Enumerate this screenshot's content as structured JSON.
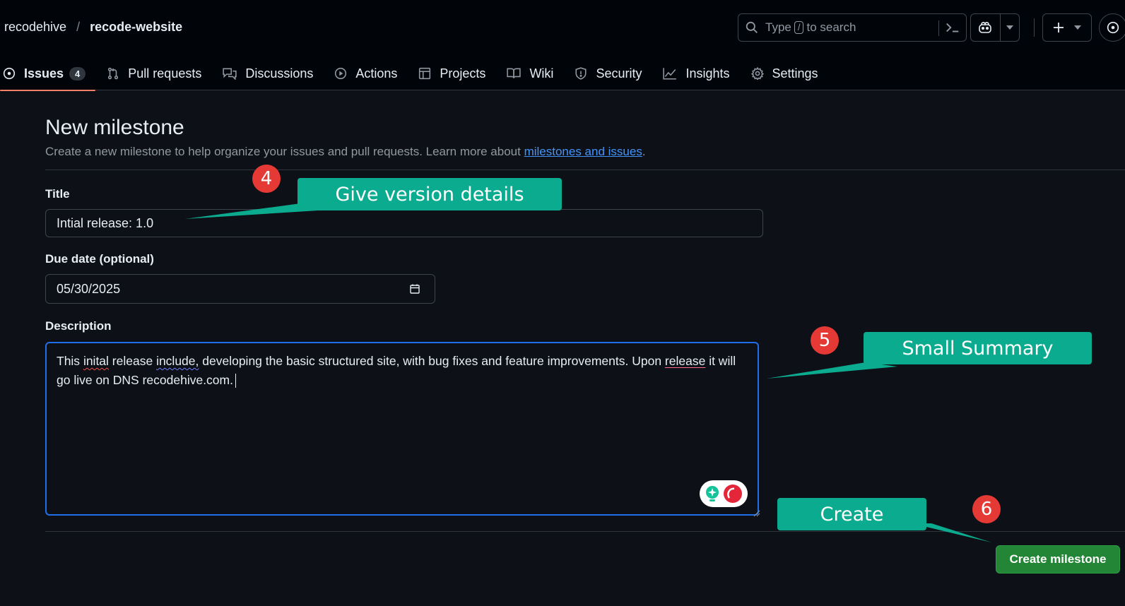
{
  "header": {
    "owner": "recodehive",
    "separator": "/",
    "repo": "recode-website",
    "search": {
      "prefix": "Type",
      "key": "/",
      "suffix": "to search"
    }
  },
  "tabs": [
    {
      "label": "Issues",
      "icon": "issue-opened-icon",
      "counter": "4",
      "selected": true
    },
    {
      "label": "Pull requests",
      "icon": "git-pull-request-icon"
    },
    {
      "label": "Discussions",
      "icon": "comment-discussion-icon"
    },
    {
      "label": "Actions",
      "icon": "play-icon"
    },
    {
      "label": "Projects",
      "icon": "table-icon"
    },
    {
      "label": "Wiki",
      "icon": "book-icon"
    },
    {
      "label": "Security",
      "icon": "shield-icon"
    },
    {
      "label": "Insights",
      "icon": "graph-icon"
    },
    {
      "label": "Settings",
      "icon": "gear-icon"
    }
  ],
  "page": {
    "title": "New milestone",
    "subtitle": "Create a new milestone to help organize your issues and pull requests. Learn more about",
    "subtitle_link": "milestones and issues",
    "subtitle_end": "."
  },
  "form": {
    "title_label": "Title",
    "title_value": "Intial release: 1.0",
    "due_label": "Due date (optional)",
    "due_value": "05/30/2025",
    "description_label": "Description",
    "description_value": {
      "w1": "This ",
      "w2": "inital",
      "w3": " release ",
      "w4": "include,",
      "w5": " developing the basic structured site, with bug fixes and feature improvements. Upon ",
      "w6": "release",
      "w7": " it will go live on DNS recodehive.com."
    },
    "submit_label": "Create milestone"
  },
  "annotations": {
    "callout_4": "Give version details",
    "callout_5": "Small Summary",
    "callout_6": "Create",
    "badge_4": "4",
    "badge_5": "5",
    "badge_6": "6"
  },
  "colors": {
    "accent_tab": "#f78166",
    "link": "#4493f8",
    "primary_button": "#238636",
    "callout": "#0bab8f",
    "badge": "#e53935",
    "focus_border": "#1f6feb"
  }
}
